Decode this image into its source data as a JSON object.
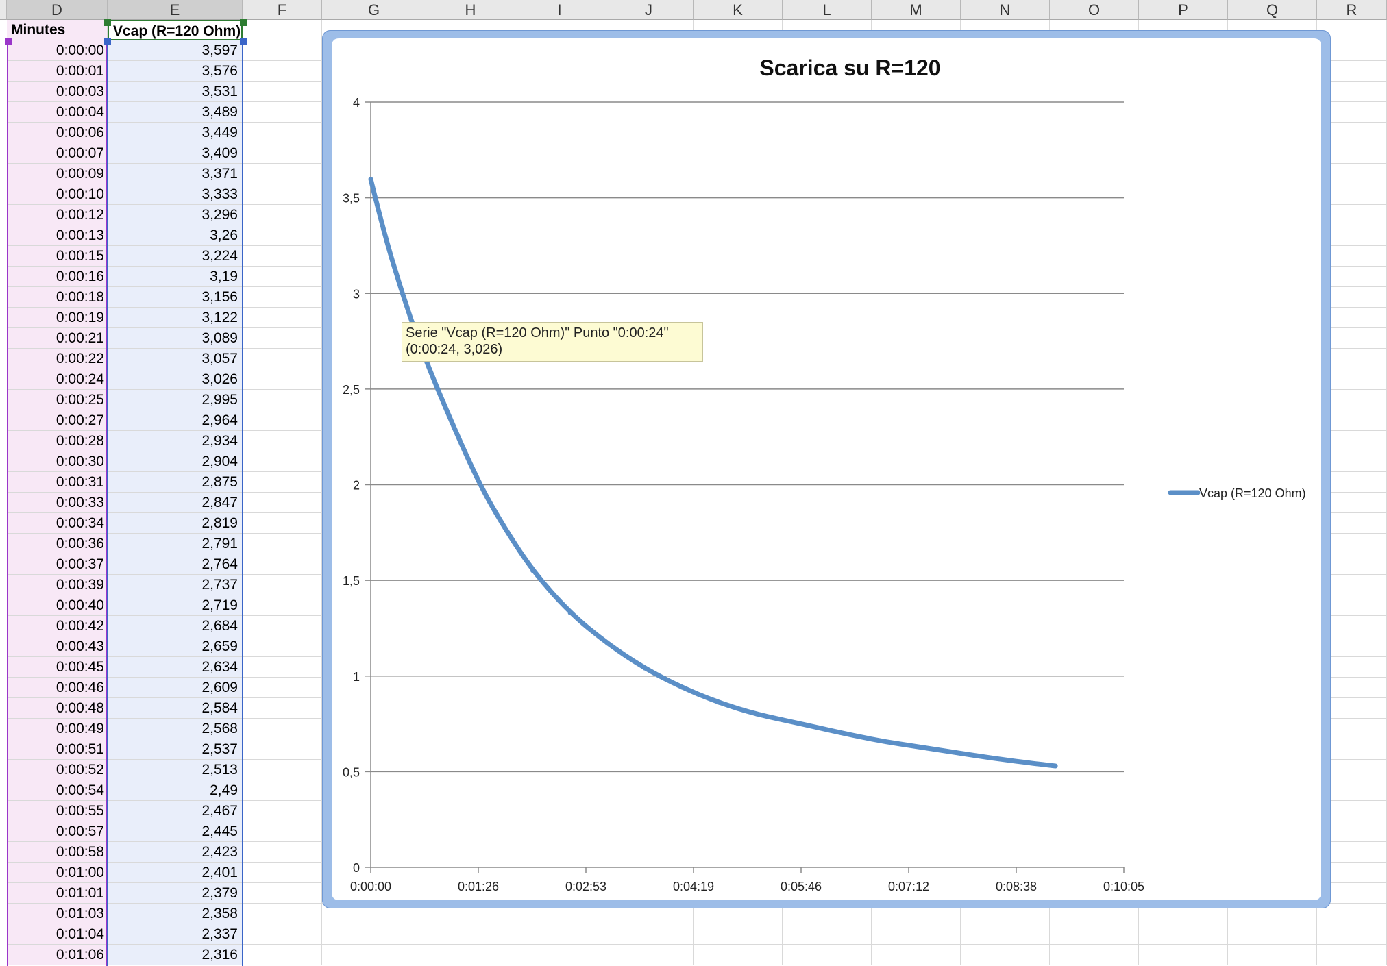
{
  "columns": [
    "D",
    "E",
    "F",
    "G",
    "H",
    "I",
    "J",
    "K",
    "L",
    "M",
    "N",
    "O",
    "P",
    "Q",
    "R"
  ],
  "sheet": {
    "header_d": "Minutes",
    "header_e": "Vcap (R=120 Ohm)",
    "rows": [
      [
        "0:00:00",
        "3,597"
      ],
      [
        "0:00:01",
        "3,576"
      ],
      [
        "0:00:03",
        "3,531"
      ],
      [
        "0:00:04",
        "3,489"
      ],
      [
        "0:00:06",
        "3,449"
      ],
      [
        "0:00:07",
        "3,409"
      ],
      [
        "0:00:09",
        "3,371"
      ],
      [
        "0:00:10",
        "3,333"
      ],
      [
        "0:00:12",
        "3,296"
      ],
      [
        "0:00:13",
        "3,26"
      ],
      [
        "0:00:15",
        "3,224"
      ],
      [
        "0:00:16",
        "3,19"
      ],
      [
        "0:00:18",
        "3,156"
      ],
      [
        "0:00:19",
        "3,122"
      ],
      [
        "0:00:21",
        "3,089"
      ],
      [
        "0:00:22",
        "3,057"
      ],
      [
        "0:00:24",
        "3,026"
      ],
      [
        "0:00:25",
        "2,995"
      ],
      [
        "0:00:27",
        "2,964"
      ],
      [
        "0:00:28",
        "2,934"
      ],
      [
        "0:00:30",
        "2,904"
      ],
      [
        "0:00:31",
        "2,875"
      ],
      [
        "0:00:33",
        "2,847"
      ],
      [
        "0:00:34",
        "2,819"
      ],
      [
        "0:00:36",
        "2,791"
      ],
      [
        "0:00:37",
        "2,764"
      ],
      [
        "0:00:39",
        "2,737"
      ],
      [
        "0:00:40",
        "2,719"
      ],
      [
        "0:00:42",
        "2,684"
      ],
      [
        "0:00:43",
        "2,659"
      ],
      [
        "0:00:45",
        "2,634"
      ],
      [
        "0:00:46",
        "2,609"
      ],
      [
        "0:00:48",
        "2,584"
      ],
      [
        "0:00:49",
        "2,568"
      ],
      [
        "0:00:51",
        "2,537"
      ],
      [
        "0:00:52",
        "2,513"
      ],
      [
        "0:00:54",
        "2,49"
      ],
      [
        "0:00:55",
        "2,467"
      ],
      [
        "0:00:57",
        "2,445"
      ],
      [
        "0:00:58",
        "2,423"
      ],
      [
        "0:01:00",
        "2,401"
      ],
      [
        "0:01:01",
        "2,379"
      ],
      [
        "0:01:03",
        "2,358"
      ],
      [
        "0:01:04",
        "2,337"
      ],
      [
        "0:01:06",
        "2,316"
      ]
    ]
  },
  "tooltip": {
    "line1": "Serie \"Vcap (R=120 Ohm)\" Punto \"0:00:24\"",
    "line2": "(0:00:24, 3,026)"
  },
  "chart_data": {
    "type": "line",
    "title": "Scarica su R=120",
    "xlabel": "",
    "ylabel": "",
    "ylim": [
      0,
      4
    ],
    "xlim": [
      "0:00:00",
      "0:10:05"
    ],
    "x_ticks": [
      "0:00:00",
      "0:01:26",
      "0:02:53",
      "0:04:19",
      "0:05:46",
      "0:07:12",
      "0:08:38",
      "0:10:05"
    ],
    "y_ticks": [
      "0",
      "0,5",
      "1",
      "1,5",
      "2",
      "2,5",
      "3",
      "3,5",
      "4"
    ],
    "y_tick_values": [
      0,
      0.5,
      1,
      1.5,
      2,
      2.5,
      3,
      3.5,
      4
    ],
    "grid": true,
    "legend": "right",
    "series": [
      {
        "name": "Vcap (R=120 Ohm)",
        "color": "#5b8fc7",
        "x": [
          "0:00:00",
          "0:00:10",
          "0:00:24",
          "0:00:40",
          "0:01:00",
          "0:01:26",
          "0:01:45",
          "0:02:10",
          "0:02:40",
          "0:03:10",
          "0:03:40",
          "0:04:10",
          "0:04:40",
          "0:05:10",
          "0:05:46",
          "0:06:20",
          "0:06:50",
          "0:07:20",
          "0:07:50",
          "0:08:20",
          "0:08:50",
          "0:09:10"
        ],
        "values": [
          3.597,
          3.333,
          3.026,
          2.719,
          2.401,
          2.02,
          1.8,
          1.55,
          1.33,
          1.17,
          1.04,
          0.94,
          0.86,
          0.8,
          0.75,
          0.7,
          0.66,
          0.63,
          0.6,
          0.57,
          0.545,
          0.53
        ]
      }
    ]
  }
}
